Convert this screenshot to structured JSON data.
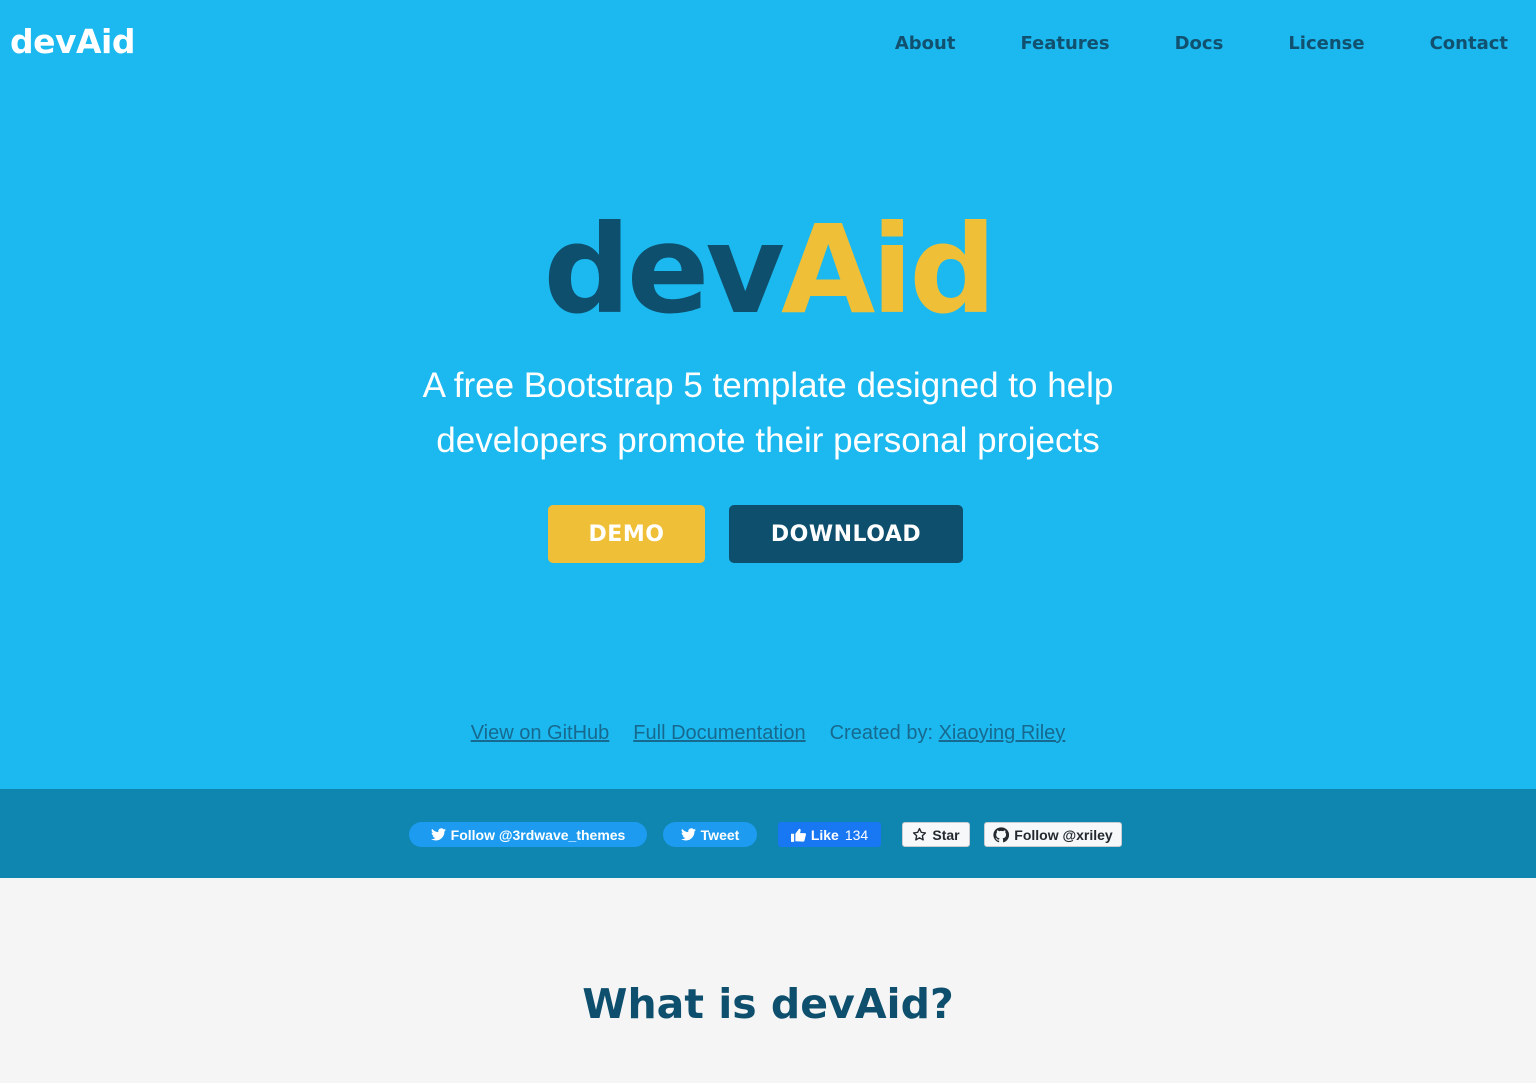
{
  "nav": {
    "logo": "devAid",
    "items": [
      {
        "label": "About"
      },
      {
        "label": "Features"
      },
      {
        "label": "Docs"
      },
      {
        "label": "License"
      },
      {
        "label": "Contact"
      }
    ]
  },
  "hero": {
    "title_dev": "dev",
    "title_aid": "Aid",
    "tagline_line1": "A free Bootstrap 5 template designed to help",
    "tagline_line2": "developers promote their personal projects",
    "demo_label": "DEMO",
    "download_label": "DOWNLOAD",
    "links": {
      "github": "View on GitHub",
      "docs": "Full Documentation",
      "created_by": "Created by:",
      "author": "Xiaoying Riley"
    }
  },
  "social": {
    "follow_twitter": "Follow @3rdwave_themes",
    "tweet": "Tweet",
    "like": "Like",
    "like_count": "134",
    "star": "Star",
    "follow_github": "Follow @xriley"
  },
  "section": {
    "title": "What is devAid?"
  },
  "colors": {
    "hero_bg": "#1bb9ef",
    "brand_dark": "#0e4f6d",
    "brand_yellow": "#f0bf38",
    "social_bar": "#0f86b0",
    "section_bg": "#f5f5f5"
  }
}
